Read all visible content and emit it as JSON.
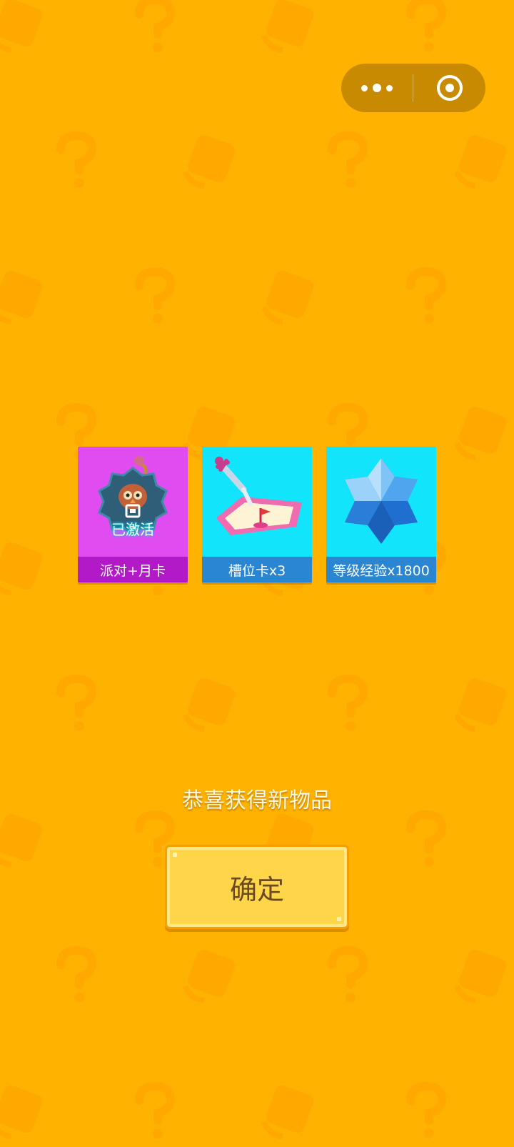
{
  "capsule": {
    "more_icon": "more-dots-icon",
    "close_icon": "target-circle-icon"
  },
  "rewards": [
    {
      "name": "派对+月卡",
      "badge": "已激活",
      "badge_icon": "qr-square-icon",
      "icon": "owl-badge-icon",
      "bg": "#E04CF0",
      "label_bg": "#B21AC8"
    },
    {
      "name": "槽位卡x3",
      "icon": "map-dagger-icon",
      "bg": "#12E4FB",
      "label_bg": "#2A86D3"
    },
    {
      "name": "等级经验x1800",
      "icon": "blue-crystal-icon",
      "bg": "#12E4FB",
      "label_bg": "#2A86D3"
    }
  ],
  "message": "恭喜获得新物品",
  "confirm_label": "确定",
  "colors": {
    "background": "#FFB300",
    "button": "#FFD54A",
    "button_text": "#6A4A1E"
  }
}
